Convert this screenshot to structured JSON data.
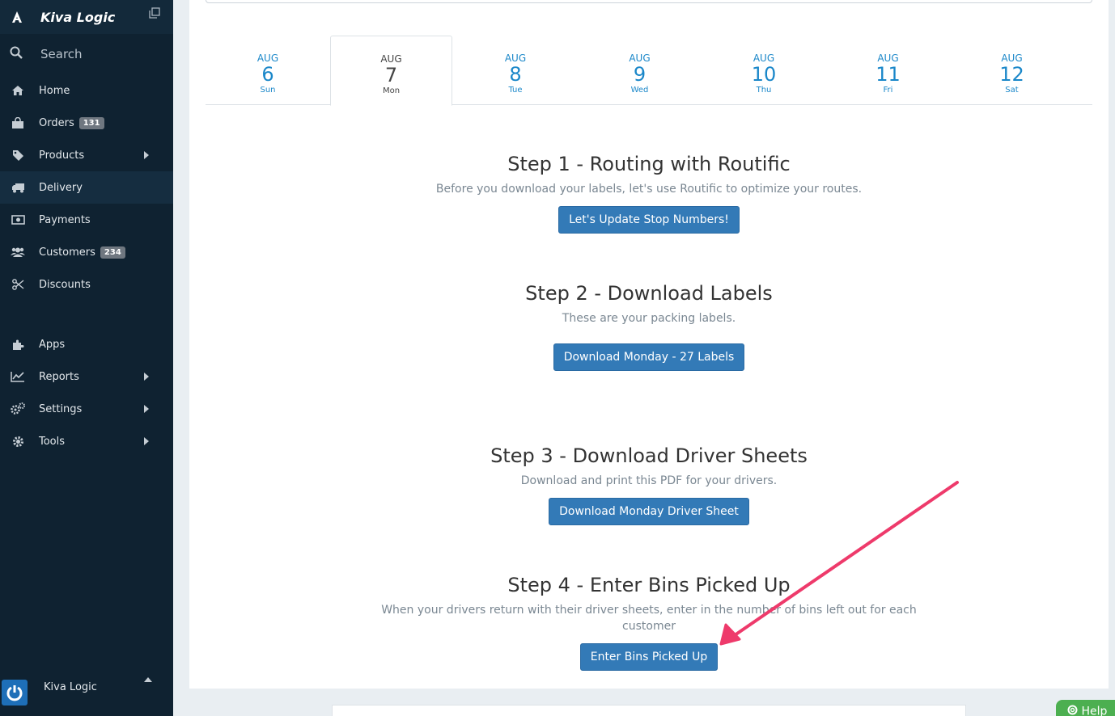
{
  "brand": {
    "name": "Kiva Logic"
  },
  "search": {
    "label": "Search"
  },
  "nav": [
    {
      "key": "home",
      "label": "Home",
      "icon": "home-icon"
    },
    {
      "key": "orders",
      "label": "Orders",
      "icon": "shopping-bag-icon",
      "badge": "131"
    },
    {
      "key": "products",
      "label": "Products",
      "icon": "tag-icon",
      "expandable": true
    },
    {
      "key": "delivery",
      "label": "Delivery",
      "icon": "truck-icon",
      "active": true
    },
    {
      "key": "payments",
      "label": "Payments",
      "icon": "money-icon"
    },
    {
      "key": "customers",
      "label": "Customers",
      "icon": "users-icon",
      "badge": "234"
    },
    {
      "key": "discounts",
      "label": "Discounts",
      "icon": "scissors-icon"
    },
    {
      "key": "apps",
      "label": "Apps",
      "icon": "puzzle-icon"
    },
    {
      "key": "reports",
      "label": "Reports",
      "icon": "line-chart-icon",
      "expandable": true
    },
    {
      "key": "settings",
      "label": "Settings",
      "icon": "gears-icon",
      "expandable": true
    },
    {
      "key": "tools",
      "label": "Tools",
      "icon": "cog-icon",
      "expandable": true
    }
  ],
  "footer": {
    "name": "Kiva Logic"
  },
  "days": [
    {
      "month": "AUG",
      "day": "6",
      "dow": "Sun"
    },
    {
      "month": "AUG",
      "day": "7",
      "dow": "Mon",
      "active": true
    },
    {
      "month": "AUG",
      "day": "8",
      "dow": "Tue"
    },
    {
      "month": "AUG",
      "day": "9",
      "dow": "Wed"
    },
    {
      "month": "AUG",
      "day": "10",
      "dow": "Thu"
    },
    {
      "month": "AUG",
      "day": "11",
      "dow": "Fri"
    },
    {
      "month": "AUG",
      "day": "12",
      "dow": "Sat"
    }
  ],
  "steps": [
    {
      "title": "Step 1 - Routing with Routific",
      "desc": "Before you download your labels, let's use Routific to optimize your routes.",
      "button": "Let's Update Stop Numbers!"
    },
    {
      "title": "Step 2 - Download Labels",
      "desc": "These are your packing labels.",
      "button": "Download Monday - 27 Labels"
    },
    {
      "title": "Step 3 - Download Driver Sheets",
      "desc": "Download and print this PDF for your drivers.",
      "button": "Download Monday Driver Sheet"
    },
    {
      "title": "Step 4 - Enter Bins Picked Up",
      "desc": "When your drivers return with their driver sheets, enter in the number of bins left out for each customer",
      "button": "Enter Bins Picked Up"
    }
  ],
  "help": {
    "label": "Help"
  },
  "colors": {
    "accent": "#337ab7",
    "annotation_arrow": "#ee3a6b",
    "sidebar": "#0f2231"
  }
}
